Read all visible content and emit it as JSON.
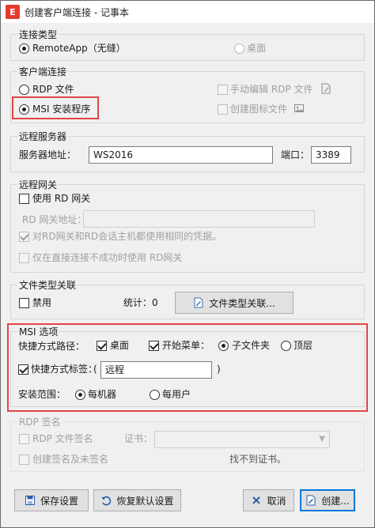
{
  "window": {
    "title": "创建客户端连接 - 记事本",
    "icon_text": "E"
  },
  "conn_type": {
    "title": "连接类型",
    "remoteapp_label": "RemoteApp（无缝）",
    "desktop_label": "桌面"
  },
  "client_conn": {
    "title": "客户端连接",
    "rdp_file_label": "RDP 文件",
    "msi_label": "MSI 安装程序",
    "manual_edit_label": "手动编辑 RDP 文件",
    "create_icon_label": "创建图标文件"
  },
  "remote_server": {
    "title": "远程服务器",
    "address_label": "服务器地址：",
    "address_value": "WS2016",
    "port_label": "端口：",
    "port_value": "3389"
  },
  "gateway": {
    "title": "远程网关",
    "use_gateway_label": "使用 RD 网关",
    "gateway_address_label": "RD 网关地址：",
    "gateway_address_value": "",
    "same_credentials_label": "对RD网关和RD会话主机都使用相同的凭据。",
    "only_if_fail_label": "仅在直接连接不成功时使用 RD网关"
  },
  "file_assoc": {
    "title": "文件类型关联",
    "disable_label": "禁用",
    "stats_label": "统计：0",
    "button_label": "文件类型关联..."
  },
  "msi_options": {
    "title": "MSI 选项",
    "shortcut_path_label": "快捷方式路径：",
    "desktop_label": "桌面",
    "start_menu_label": "开始菜单：",
    "subfolder_label": "子文件夹",
    "toplevel_label": "顶层",
    "shortcut_tag_label": "快捷方式标签：",
    "paren_open": "(",
    "shortcut_tag_value": "远程",
    "paren_close": ")",
    "install_scope_label": "安装范围：",
    "per_machine_label": "每机器",
    "per_user_label": "每用户"
  },
  "rdp_sign": {
    "title": "RDP 签名",
    "sign_label": "RDP 文件签名",
    "cert_label": "证书：",
    "create_sign_label": "创建签名及未签名",
    "no_cert_text": "找不到证书。"
  },
  "buttons": {
    "save_settings": "保存设置",
    "restore_defaults": "恢复默认设置",
    "cancel": "取消",
    "create": "创建..."
  },
  "colors": {
    "highlight_box": "#e04646",
    "default_button_border": "#0078d7"
  }
}
